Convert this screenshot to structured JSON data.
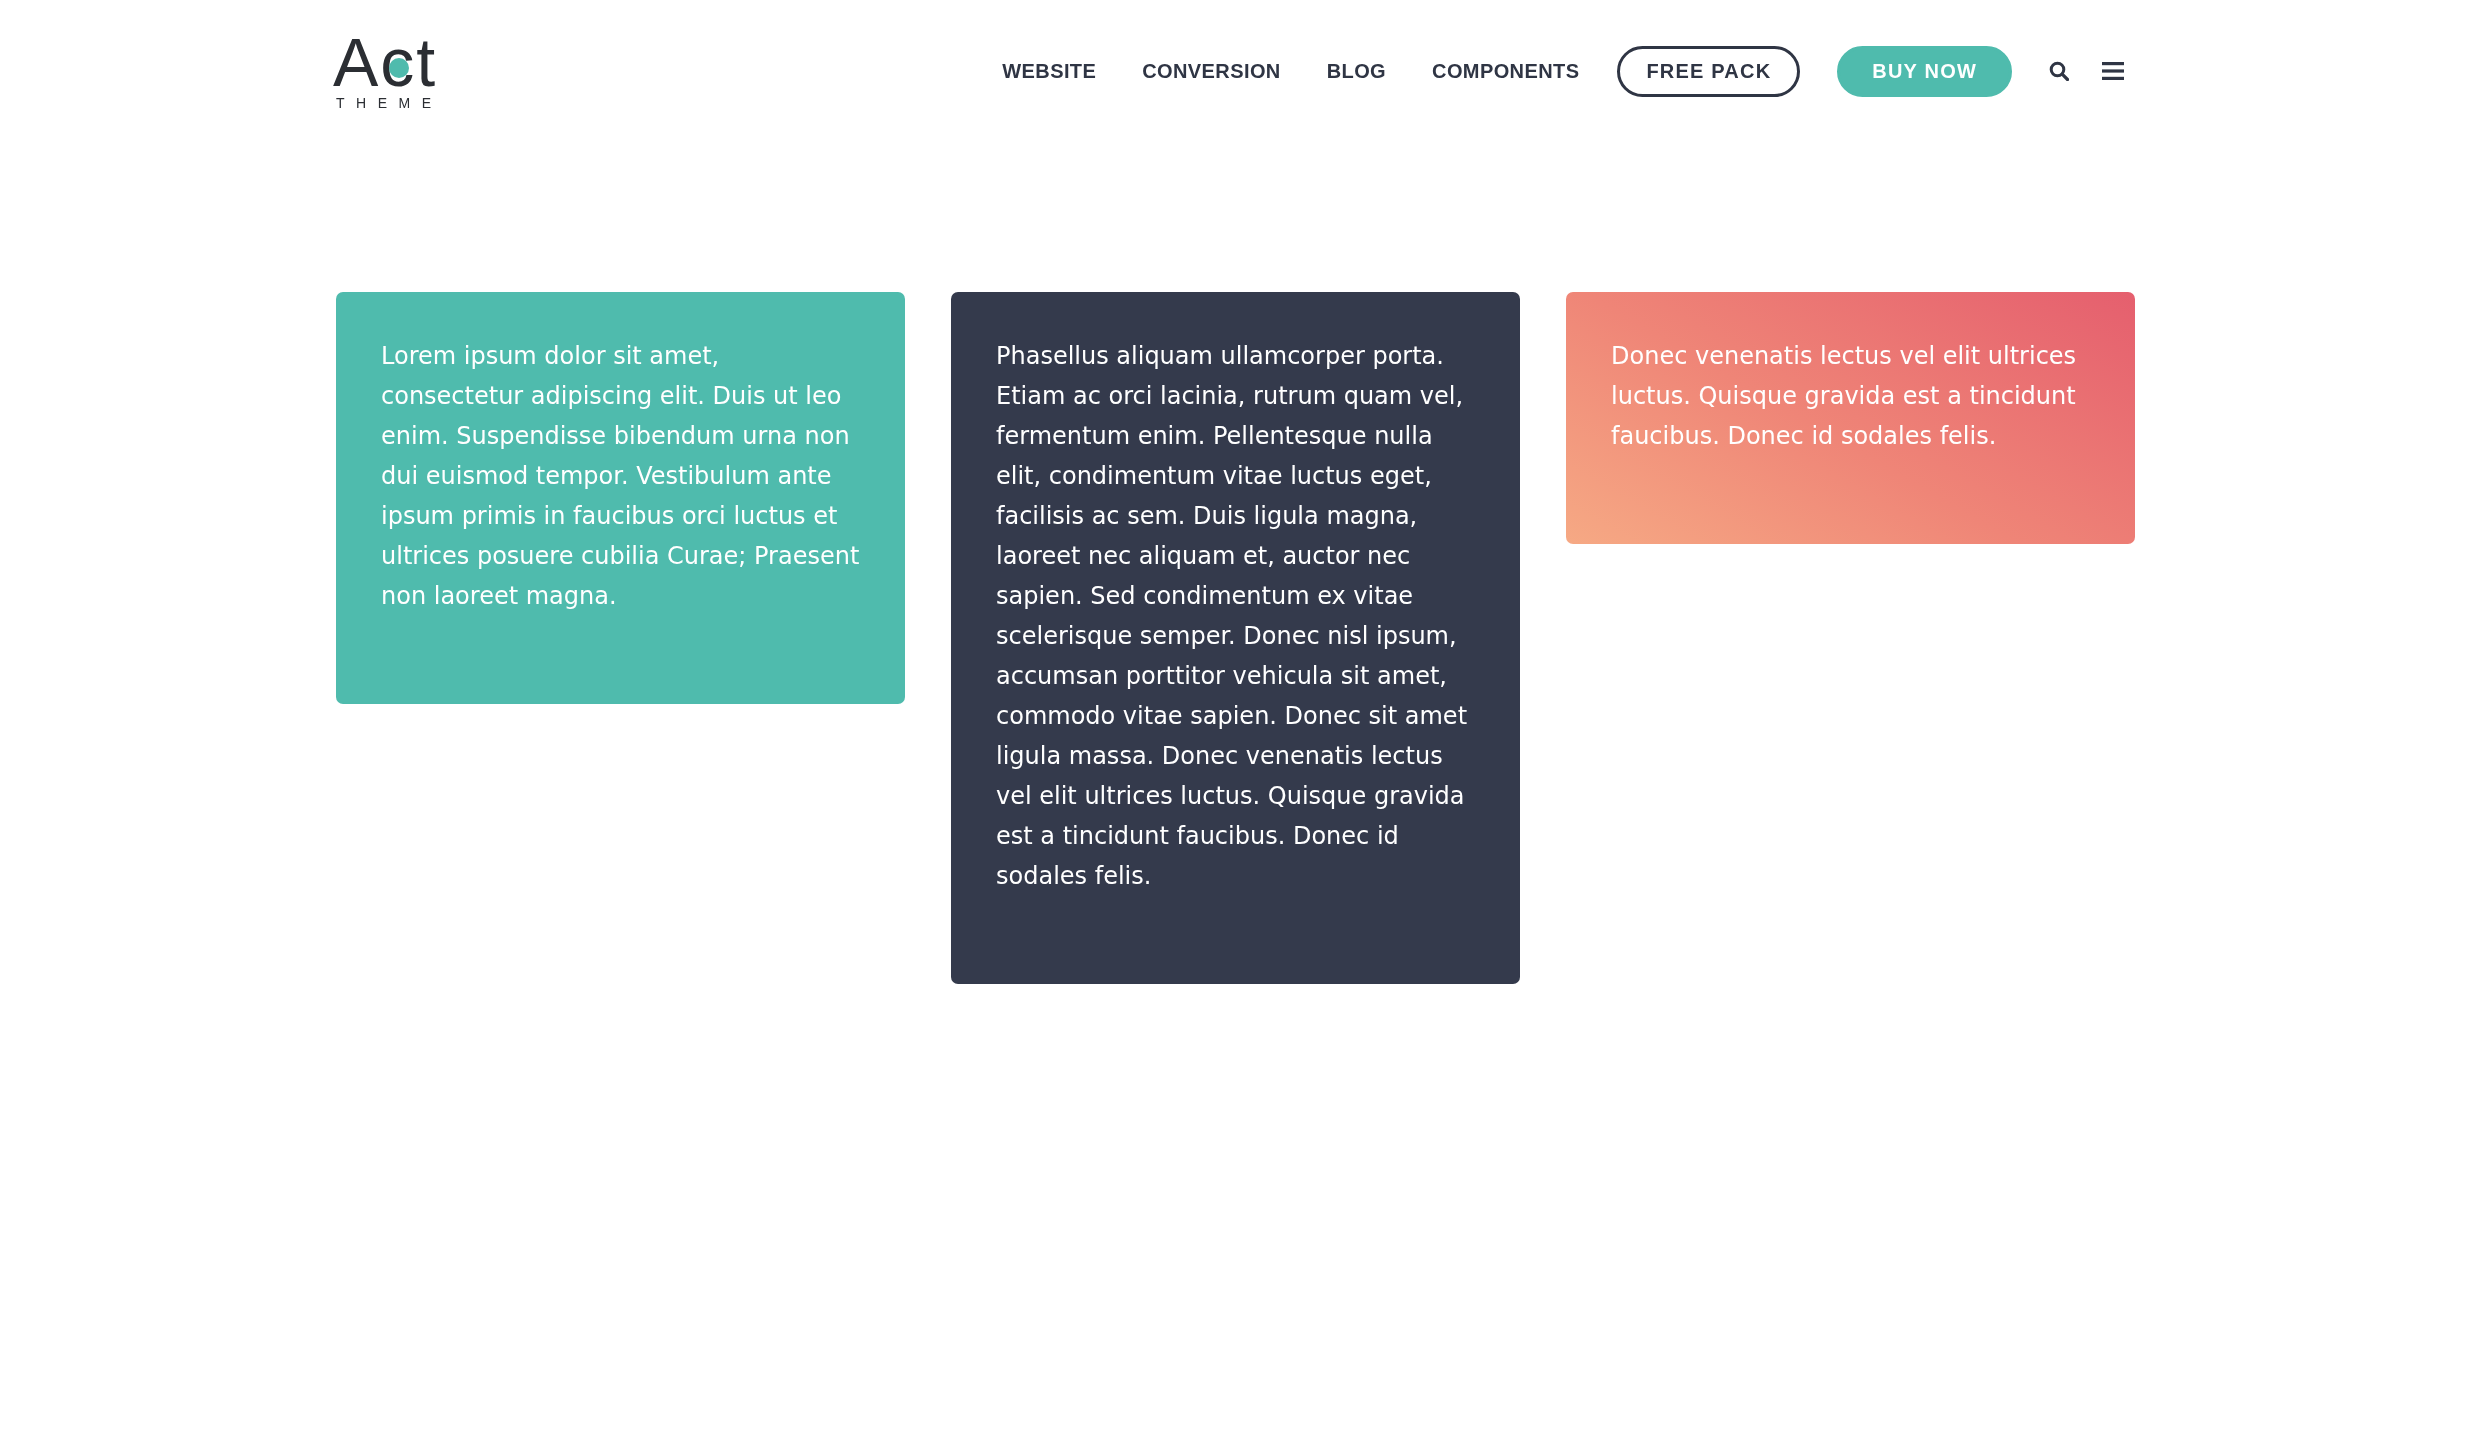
{
  "logo": {
    "title": "Act",
    "subtitle": "THEME"
  },
  "nav": {
    "links": [
      {
        "label": "WEBSITE"
      },
      {
        "label": "CONVERSION"
      },
      {
        "label": "BLOG"
      },
      {
        "label": "COMPONENTS"
      }
    ],
    "buttons": [
      {
        "label": "FREE PACK",
        "kind": "outline"
      },
      {
        "label": "BUY NOW",
        "kind": "filled"
      }
    ]
  },
  "cards": [
    {
      "kind": "teal",
      "text": "Lorem ipsum dolor sit amet, consectetur adipiscing elit. Duis ut leo enim. Suspendisse bibendum urna non dui euismod tempor. Vestibulum ante ipsum primis in faucibus orci luctus et ultrices posuere cubilia Curae; Praesent non laoreet magna."
    },
    {
      "kind": "dark",
      "text": "Phasellus aliquam ullamcorper porta. Etiam ac orci lacinia, rutrum quam vel, fermentum enim. Pellentesque nulla elit, condimentum vitae luctus eget, facilisis ac sem. Duis ligula magna, laoreet nec aliquam et, auctor nec sapien. Sed condimentum ex vitae scelerisque semper. Donec nisl ipsum, accumsan porttitor vehicula sit amet, commodo vitae sapien. Donec sit amet ligula massa. Donec venenatis lectus vel elit ultrices luctus. Quisque gravida est a tincidunt faucibus. Donec id sodales felis."
    },
    {
      "kind": "gradient",
      "text": "Donec venenatis lectus vel elit ultrices luctus. Quisque gravida est a tincidunt faucibus. Donec id sodales felis."
    }
  ]
}
